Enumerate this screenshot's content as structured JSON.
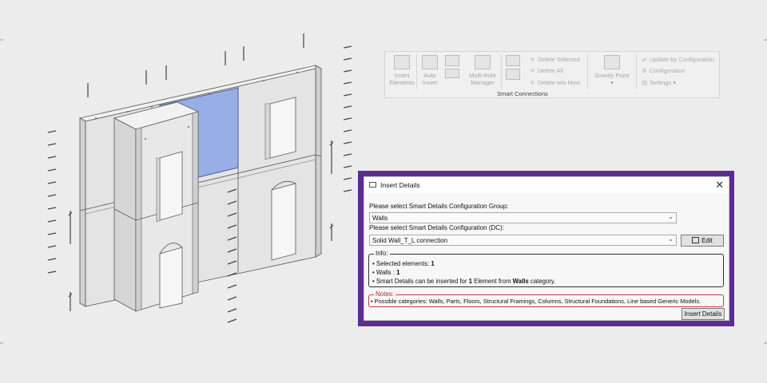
{
  "ribbon": {
    "insert_elements": "Insert Elements",
    "auto_insert": "Auto Insert",
    "multi_rule_manager": "Multi-Rule Manager",
    "delete_selected": "Delete  Selected",
    "delete_all": "Delete All",
    "delete_wo_host": "Delete  w/o Host",
    "gravity_point": "Gravity Point",
    "update_by_configuration": "Update by Configuration",
    "configuration": "Configuration",
    "settings": "Settings",
    "group_label": "Smart Connections"
  },
  "dialog": {
    "title": "Insert Details",
    "close": "✕",
    "group_prompt": "Please select Smart Details Configuration Group:",
    "group_value": "Walls",
    "dc_prompt": "Please select Smart Details Configuration (DC):",
    "dc_value": "Solid Wall_T_L connection",
    "edit_label": "Edit",
    "info": {
      "legend": "Info:",
      "selected_prefix": "• Selected elements:",
      "selected_count": "1",
      "walls_prefix": "• Walls  :",
      "walls_count": "1",
      "smart_prefix": "• Smart Details can be inserted for",
      "smart_count": "1",
      "smart_middle": "Element from",
      "smart_category": "Walls",
      "smart_suffix": "category."
    },
    "notes": {
      "legend": "Notes:",
      "text": "• Possible categories: Walls, Parts, Floors, Structural Framings, Columns, Structural Foundations, Line based Generic Models."
    },
    "insert_label": "Insert Details"
  },
  "colors": {
    "dialog_frame": "#5c2d91",
    "selected_panel": "#9aaee6",
    "wall_face": "#e4e4e4",
    "notes_border": "#c43c3c"
  }
}
